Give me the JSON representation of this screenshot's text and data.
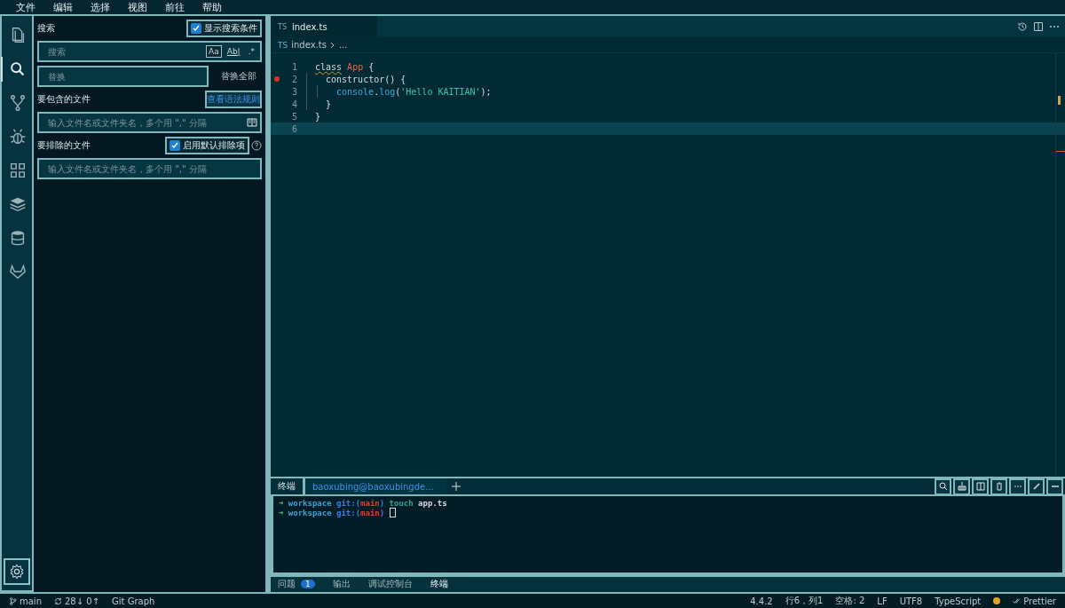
{
  "menu": [
    "文件",
    "编辑",
    "选择",
    "视图",
    "前往",
    "帮助"
  ],
  "activity_bar": {
    "items": [
      {
        "selected": false
      },
      {
        "selected": true
      },
      {
        "selected": false
      },
      {
        "selected": false
      },
      {
        "selected": false
      },
      {
        "selected": false
      },
      {
        "selected": false
      },
      {
        "selected": false
      }
    ]
  },
  "search_panel": {
    "title": "搜索",
    "show_conditions": {
      "label": "显示搜索条件",
      "checked": true
    },
    "search_field": {
      "placeholder": "搜索"
    },
    "toggles": [
      {
        "label": "Aa",
        "selected": true
      },
      {
        "label": "Ab|",
        "selected": false
      },
      {
        "label": ".*",
        "selected": false
      }
    ],
    "replace_field": {
      "placeholder": "替换"
    },
    "replace_all": "替换全部",
    "include": {
      "label": "要包含的文件",
      "link": "查看语法规则",
      "placeholder": "输入文件名或文件夹名，多个用 \",\" 分隔"
    },
    "exclude": {
      "label": "要排除的文件",
      "checkbox": {
        "label": "启用默认排除项",
        "checked": true
      },
      "placeholder": "输入文件名或文件夹名，多个用 \",\" 分隔"
    }
  },
  "editor": {
    "tabs": [
      {
        "badge": "TS",
        "label": "index.ts",
        "selected": true
      }
    ],
    "breadcrumb": {
      "badge": "TS",
      "items": [
        "index.ts",
        "..."
      ]
    },
    "lines": [
      {
        "number": "1",
        "breakpoint": false,
        "current": false,
        "tokens": [
          {
            "text": "class",
            "kind": "keyword"
          },
          {
            "text": "App",
            "kind": "type",
            "space_before": true
          },
          {
            "text": "{",
            "kind": "plain",
            "space_before": true
          }
        ],
        "children": [
          {
            "number": "2",
            "breakpoint": true,
            "current": false,
            "tokens": [
              {
                "text": "constructor() {",
                "kind": "plain"
              }
            ],
            "children": [
              {
                "number": "3",
                "breakpoint": false,
                "current": false,
                "tokens": [
                  {
                    "text": "console",
                    "kind": "variable"
                  },
                  {
                    "text": ".",
                    "kind": "plain"
                  },
                  {
                    "text": "log",
                    "kind": "variable"
                  },
                  {
                    "text": "(",
                    "kind": "plain"
                  },
                  {
                    "text": "'Hello KAITIAN'",
                    "kind": "string"
                  },
                  {
                    "text": ");",
                    "kind": "plain"
                  }
                ]
              }
            ]
          },
          {
            "number": "4",
            "breakpoint": false,
            "current": false,
            "tokens": [
              {
                "text": "}",
                "kind": "plain"
              }
            ]
          }
        ]
      },
      {
        "number": "5",
        "breakpoint": false,
        "current": false,
        "tokens": [
          {
            "text": "}",
            "kind": "plain"
          }
        ]
      },
      {
        "number": "6",
        "breakpoint": false,
        "current": true
      }
    ]
  },
  "panel": {
    "title": "终端",
    "terminal_tab": "baoxubing@baoxubingde...",
    "terminal_lines": [
      {
        "cursor": false,
        "tokens": [
          {
            "text": "➜",
            "kind": "arrow"
          },
          {
            "text": "workspace",
            "kind": "dir",
            "space_before": true
          },
          {
            "text": "git:(",
            "kind": "git",
            "space_before": true
          },
          {
            "text": "main",
            "kind": "branch"
          },
          {
            "text": ")",
            "kind": "git"
          },
          {
            "text": "touch",
            "kind": "command",
            "space_before": true
          },
          {
            "text": "app.ts",
            "kind": "plain",
            "space_before": true
          }
        ]
      },
      {
        "cursor": true,
        "tokens": [
          {
            "text": "➜",
            "kind": "arrow"
          },
          {
            "text": "workspace",
            "kind": "dir",
            "space_before": true
          },
          {
            "text": "git:(",
            "kind": "git",
            "space_before": true
          },
          {
            "text": "main",
            "kind": "branch"
          },
          {
            "text": ")",
            "kind": "git"
          }
        ]
      }
    ],
    "tabs": [
      {
        "label": "问题",
        "badge": "1",
        "selected": false
      },
      {
        "label": "输出",
        "selected": false
      },
      {
        "label": "调试控制台",
        "selected": false
      },
      {
        "label": "终端",
        "selected": true
      }
    ]
  },
  "status_bar": {
    "branch": "main",
    "sync": "28↓ 0↑",
    "git_graph": "Git Graph",
    "version": "4.4.2",
    "position": "行6，列1",
    "spaces": "空格: 2",
    "eol": "LF",
    "encoding": "UTF8",
    "language": "TypeScript",
    "formatter": "Prettier"
  }
}
